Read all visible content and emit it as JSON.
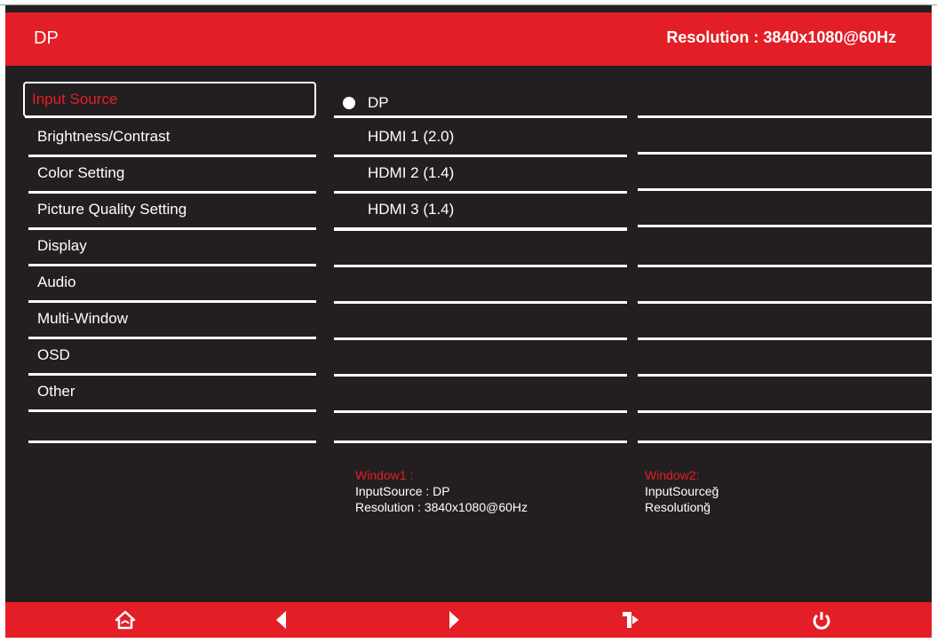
{
  "header": {
    "source": "DP",
    "resolution": "Resolution :  3840x1080@60Hz"
  },
  "menu": {
    "items": [
      {
        "label": "Input Source",
        "selected": true
      },
      {
        "label": "Brightness/Contrast"
      },
      {
        "label": "Color Setting"
      },
      {
        "label": "Picture Quality Setting"
      },
      {
        "label": "Display"
      },
      {
        "label": "Audio"
      },
      {
        "label": "Multi-Window"
      },
      {
        "label": "OSD"
      },
      {
        "label": "Other"
      }
    ]
  },
  "submenu": {
    "items": [
      {
        "label": "DP",
        "active": true
      },
      {
        "label": "HDMI 1 (2.0)"
      },
      {
        "label": "HDMI 2 (1.4)"
      },
      {
        "label": "HDMI 3 (1.4)"
      }
    ]
  },
  "window1": {
    "title": "Window1 :",
    "input": "InputSource :  DP",
    "resolution": "Resolution :  3840x1080@60Hz"
  },
  "window2": {
    "title": "Window2:",
    "input": "InputSourceğ",
    "resolution": "Resolutionğ"
  },
  "footer": {
    "buttons": [
      {
        "name": "home",
        "icon": "home-icon"
      },
      {
        "name": "left",
        "icon": "left-arrow-icon"
      },
      {
        "name": "right",
        "icon": "right-arrow-icon"
      },
      {
        "name": "exit",
        "icon": "exit-icon"
      },
      {
        "name": "power",
        "icon": "power-icon"
      }
    ]
  },
  "colors": {
    "accent": "#e41e26",
    "background": "#231f20",
    "text": "#ffffff"
  }
}
